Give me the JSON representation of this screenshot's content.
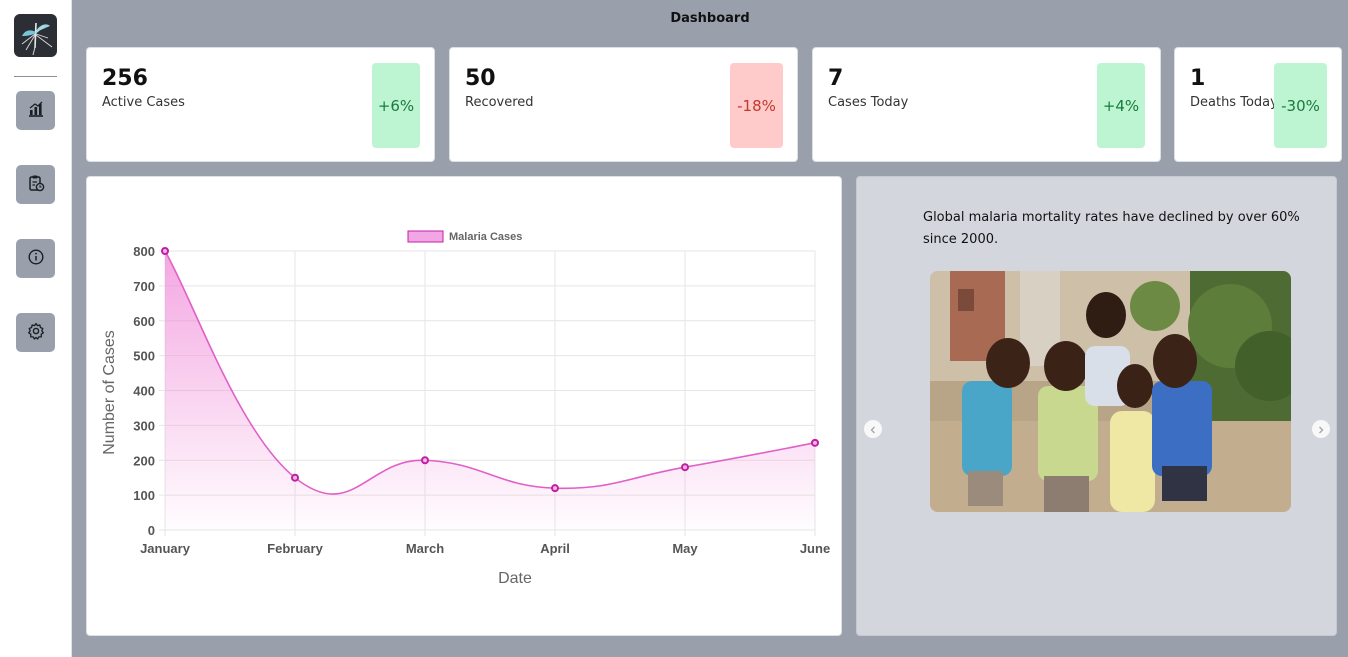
{
  "header": {
    "title": "Dashboard"
  },
  "sidebar": {
    "logo_icon": "mosquito-logo",
    "items": [
      {
        "icon": "bar-chart-icon"
      },
      {
        "icon": "clipboard-clock-icon"
      },
      {
        "icon": "info-icon"
      },
      {
        "icon": "gear-icon"
      }
    ]
  },
  "stats": [
    {
      "value": "256",
      "label": "Active Cases",
      "change": "+6%",
      "trend": "up"
    },
    {
      "value": "50",
      "label": "Recovered",
      "change": "-18%",
      "trend": "down"
    },
    {
      "value": "7",
      "label": "Cases Today",
      "change": "+4%",
      "trend": "up"
    },
    {
      "value": "1",
      "label": "Deaths Today",
      "change": "-30%",
      "trend": "up"
    }
  ],
  "colors": {
    "up_bg": "#bdf5d3",
    "up_text": "#1a7a3c",
    "down_bg": "#ffcaca",
    "down_text": "#c0392b",
    "series_line": "#e060c8",
    "series_point": "#c020a0"
  },
  "chart_data": {
    "type": "line",
    "title": "",
    "categories": [
      "January",
      "February",
      "March",
      "April",
      "May",
      "June"
    ],
    "series": [
      {
        "name": "Malaria Cases",
        "values": [
          800,
          150,
          200,
          120,
          180,
          250
        ]
      }
    ],
    "xlabel": "Date",
    "ylabel": "Number of Cases",
    "ylim": [
      0,
      800
    ],
    "yticks": [
      0,
      100,
      200,
      300,
      400,
      500,
      600,
      700,
      800
    ],
    "grid": true,
    "legend": "top-center",
    "fill": true
  },
  "info_panel": {
    "fact": "Global malaria mortality rates have declined by over 60% since 2000.",
    "prev_icon": "chevron-left-icon",
    "next_icon": "chevron-right-icon"
  }
}
